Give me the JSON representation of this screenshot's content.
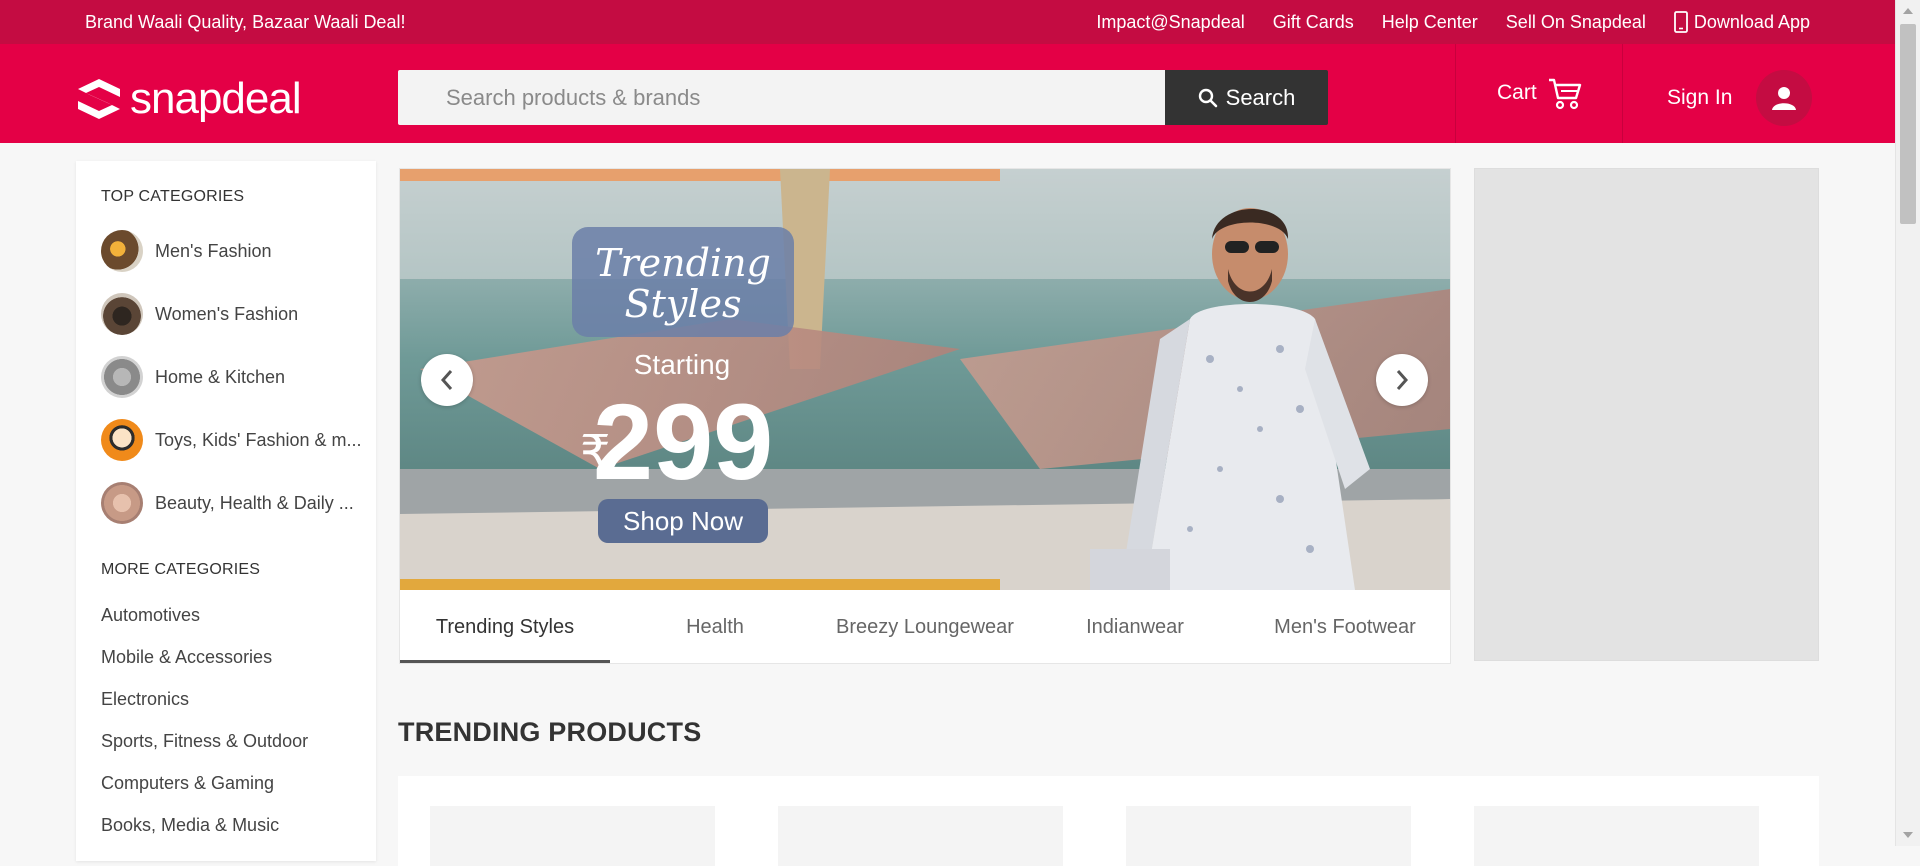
{
  "topbar": {
    "tagline": "Brand Waali Quality, Bazaar Waali Deal!",
    "links": [
      "Impact@Snapdeal",
      "Gift Cards",
      "Help Center",
      "Sell On Snapdeal"
    ],
    "download_app": "Download App"
  },
  "header": {
    "logo_text": "snapdeal",
    "search_placeholder": "Search products & brands",
    "search_button": "Search",
    "cart_label": "Cart",
    "signin_label": "Sign In"
  },
  "sidebar": {
    "top_heading": "TOP CATEGORIES",
    "top_categories": [
      {
        "label": "Men's Fashion",
        "color": "#6b4a2d"
      },
      {
        "label": "Women's Fashion",
        "color": "#5a4536"
      },
      {
        "label": "Home & Kitchen",
        "color": "#8a8a8a"
      },
      {
        "label": "Toys, Kids' Fashion & m...",
        "color": "#f08a1a"
      },
      {
        "label": "Beauty, Health & Daily ...",
        "color": "#c79a86"
      }
    ],
    "more_heading": "MORE CATEGORIES",
    "more_categories": [
      "Automotives",
      "Mobile & Accessories",
      "Electronics",
      "Sports, Fitness & Outdoor",
      "Computers & Gaming",
      "Books, Media & Music"
    ]
  },
  "banner": {
    "headline_line1": "Trending",
    "headline_line2": "Styles",
    "starting": "Starting",
    "currency": "₹",
    "price": "299",
    "cta": "Shop Now",
    "tabs": [
      {
        "label": "Trending Styles",
        "active": true
      },
      {
        "label": "Health",
        "active": false
      },
      {
        "label": "Breezy Loungewear",
        "active": false
      },
      {
        "label": "Indianwear",
        "active": false
      },
      {
        "label": "Men's Footwear",
        "active": false
      }
    ]
  },
  "trending": {
    "title": "TRENDING PRODUCTS"
  },
  "colors": {
    "brand": "#e40046",
    "brand_dark": "#c40c42",
    "search_button": "#333333"
  }
}
